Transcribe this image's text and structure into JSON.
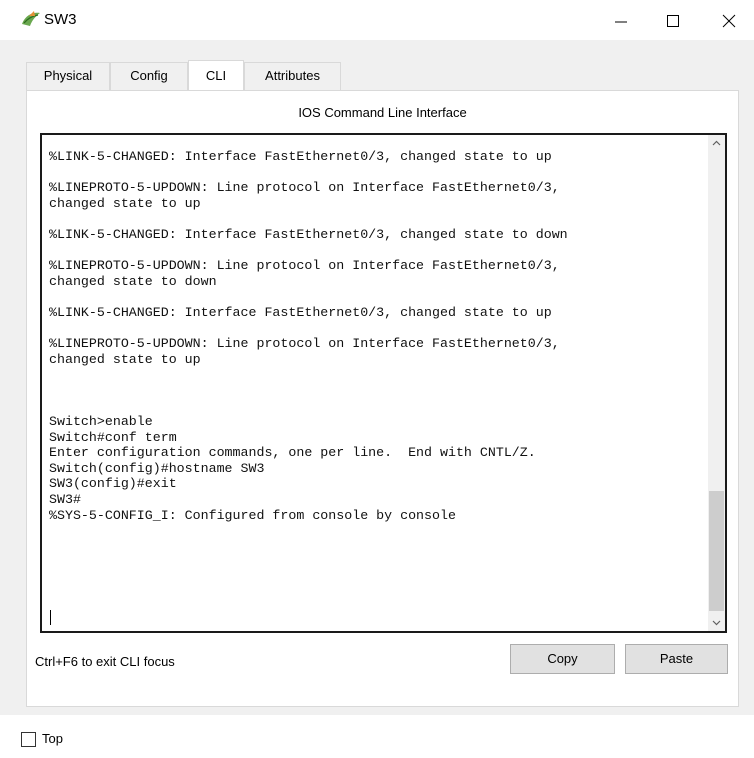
{
  "window": {
    "title": "SW3",
    "icons": {
      "app": "router-icon",
      "minimize": "minimize-icon",
      "maximize": "maximize-icon",
      "close": "close-icon"
    }
  },
  "tabs": [
    {
      "label": "Physical",
      "active": false
    },
    {
      "label": "Config",
      "active": false
    },
    {
      "label": "CLI",
      "active": true
    },
    {
      "label": "Attributes",
      "active": false
    }
  ],
  "cli": {
    "header": "IOS Command Line Interface",
    "output": "%LINK-5-CHANGED: Interface FastEthernet0/3, changed state to up\n\n%LINEPROTO-5-UPDOWN: Line protocol on Interface FastEthernet0/3,\nchanged state to up\n\n%LINK-5-CHANGED: Interface FastEthernet0/3, changed state to down\n\n%LINEPROTO-5-UPDOWN: Line protocol on Interface FastEthernet0/3,\nchanged state to down\n\n%LINK-5-CHANGED: Interface FastEthernet0/3, changed state to up\n\n%LINEPROTO-5-UPDOWN: Line protocol on Interface FastEthernet0/3,\nchanged state to up\n\n\n\nSwitch>enable\nSwitch#conf term\nEnter configuration commands, one per line.  End with CNTL/Z.\nSwitch(config)#hostname SW3\nSW3(config)#exit\nSW3#\n%SYS-5-CONFIG_I: Configured from console by console",
    "focus_hint": "Ctrl+F6 to exit CLI focus",
    "copy_label": "Copy",
    "paste_label": "Paste"
  },
  "bottom": {
    "top_label": "Top",
    "top_checked": false
  },
  "colors": {
    "panel_bg": "#f0f0f0",
    "terminal_border": "#1a1a1a",
    "button_bg": "#e1e1e1",
    "scroll_thumb": "#cdcdcd"
  }
}
